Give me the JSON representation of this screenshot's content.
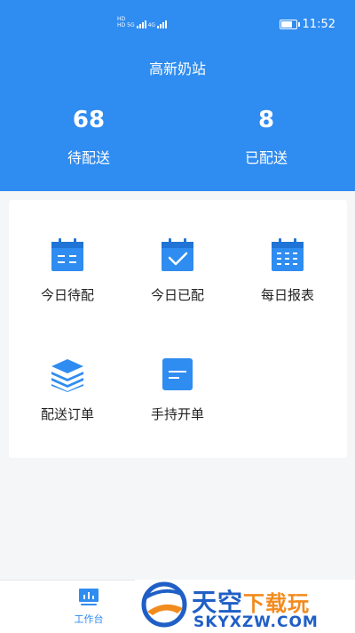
{
  "status_bar": {
    "time": "11:52",
    "network_1": "5G",
    "network_2": "4G",
    "hd_1": "HD",
    "hd_2": "HD"
  },
  "header": {
    "station_name": "高新奶站",
    "stats": [
      {
        "value": "68",
        "label": "待配送"
      },
      {
        "value": "8",
        "label": "已配送"
      }
    ]
  },
  "menu": [
    {
      "label": "今日待配",
      "icon": "calendar-list-icon"
    },
    {
      "label": "今日已配",
      "icon": "calendar-check-icon"
    },
    {
      "label": "每日报表",
      "icon": "calendar-grid-icon"
    },
    {
      "label": "配送订单",
      "icon": "layers-icon"
    },
    {
      "label": "手持开单",
      "icon": "document-icon"
    }
  ],
  "tabbar": {
    "items": [
      {
        "label": "工作台",
        "icon": "dashboard-icon",
        "active": true
      }
    ]
  },
  "watermark": {
    "brand_main": "天空",
    "brand_accent": "下载玩",
    "brand_url": "SKYXZW.COM"
  },
  "colors": {
    "primary": "#2f8cf0",
    "watermark_blue": "#1f5fc6",
    "watermark_orange": "#f28b1e"
  }
}
